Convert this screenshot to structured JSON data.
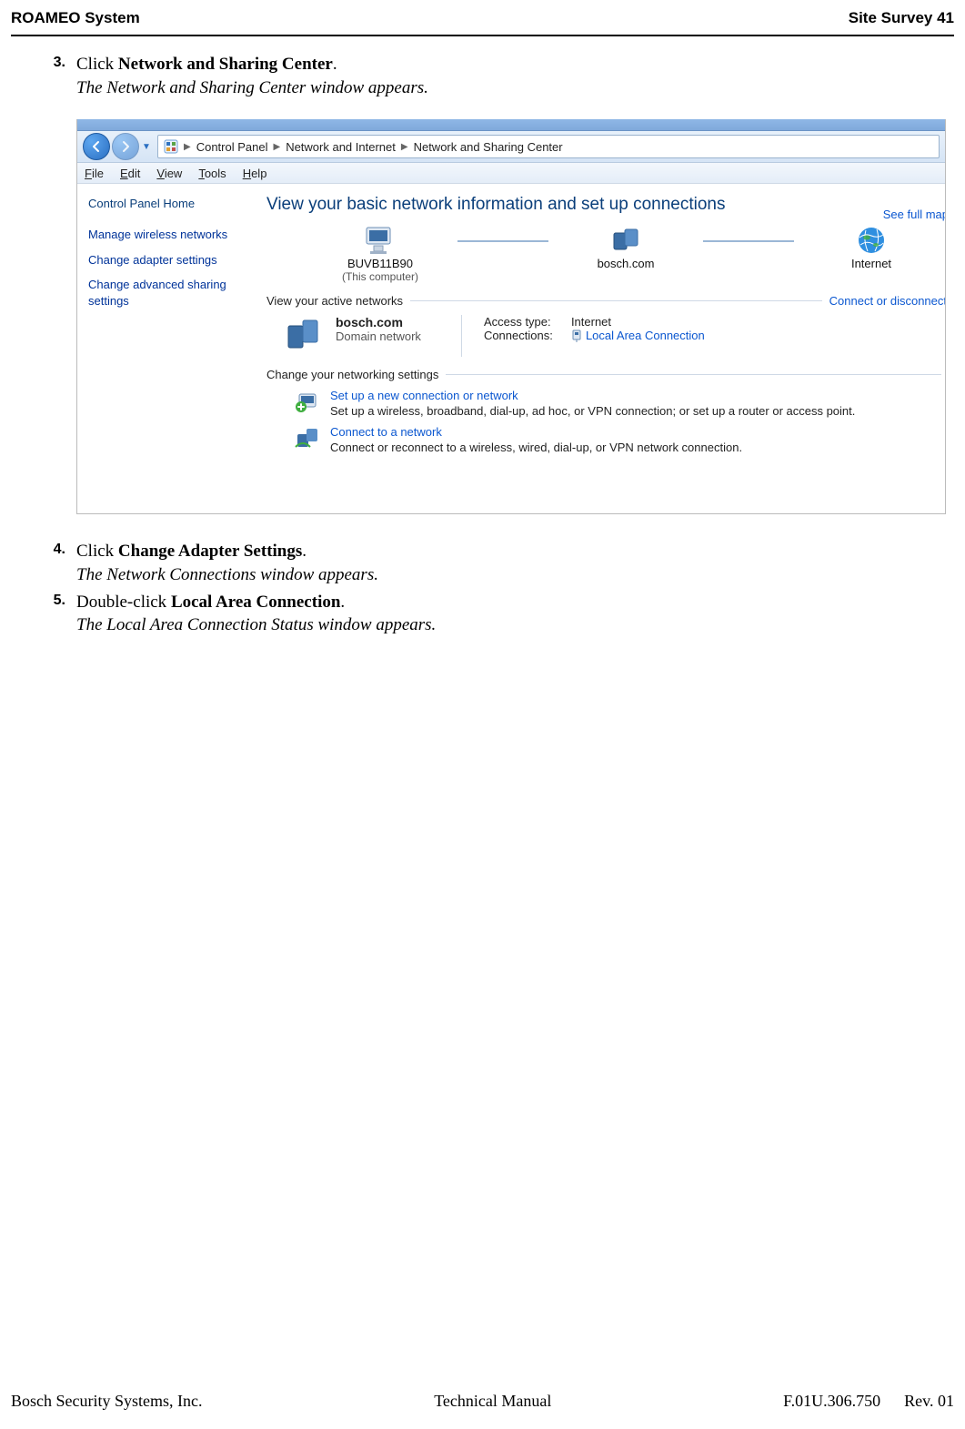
{
  "header": {
    "left": "ROAMEO System",
    "right": "Site Survey  41"
  },
  "steps": [
    {
      "num": "3.",
      "pre": "Click ",
      "bold": "Network and Sharing Center",
      "post": ".",
      "result": "The Network and Sharing Center window appears."
    },
    {
      "num": "4.",
      "pre": "Click ",
      "bold": "Change Adapter Settings",
      "post": ".",
      "result": "The Network Connections window appears."
    },
    {
      "num": "5.",
      "pre": "Double-click ",
      "bold": "Local Area Connection",
      "post": ".",
      "result": "The Local Area Connection Status window appears."
    }
  ],
  "screenshot": {
    "breadcrumb": [
      "Control Panel",
      "Network and Internet",
      "Network and Sharing Center"
    ],
    "menubar": [
      "File",
      "Edit",
      "View",
      "Tools",
      "Help"
    ],
    "left_pane": {
      "home": "Control Panel Home",
      "links": [
        "Manage wireless networks",
        "Change adapter settings",
        "Change advanced sharing settings"
      ]
    },
    "right_pane": {
      "heading": "View your basic network information and set up connections",
      "see_full_map": "See full map",
      "map": {
        "node1": "BUVB11B90",
        "node1_sub": "(This computer)",
        "node2": "bosch.com",
        "node3": "Internet"
      },
      "active_section": {
        "label": "View your active networks",
        "rlink": "Connect or disconnect",
        "net_name": "bosch.com",
        "net_type": "Domain network",
        "access_k": "Access type:",
        "access_v": "Internet",
        "conn_k": "Connections:",
        "conn_v": "Local Area Connection"
      },
      "change_section_label": "Change your networking settings",
      "items": [
        {
          "title": "Set up a new connection or network",
          "desc": "Set up a wireless, broadband, dial-up, ad hoc, or VPN connection; or set up a router or access point."
        },
        {
          "title": "Connect to a network",
          "desc": "Connect or reconnect to a wireless, wired, dial-up, or VPN network connection."
        }
      ]
    }
  },
  "footer": {
    "left": "Bosch Security Systems, Inc.",
    "center": "Technical Manual",
    "doc": "F.01U.306.750",
    "rev": "Rev. 01"
  }
}
